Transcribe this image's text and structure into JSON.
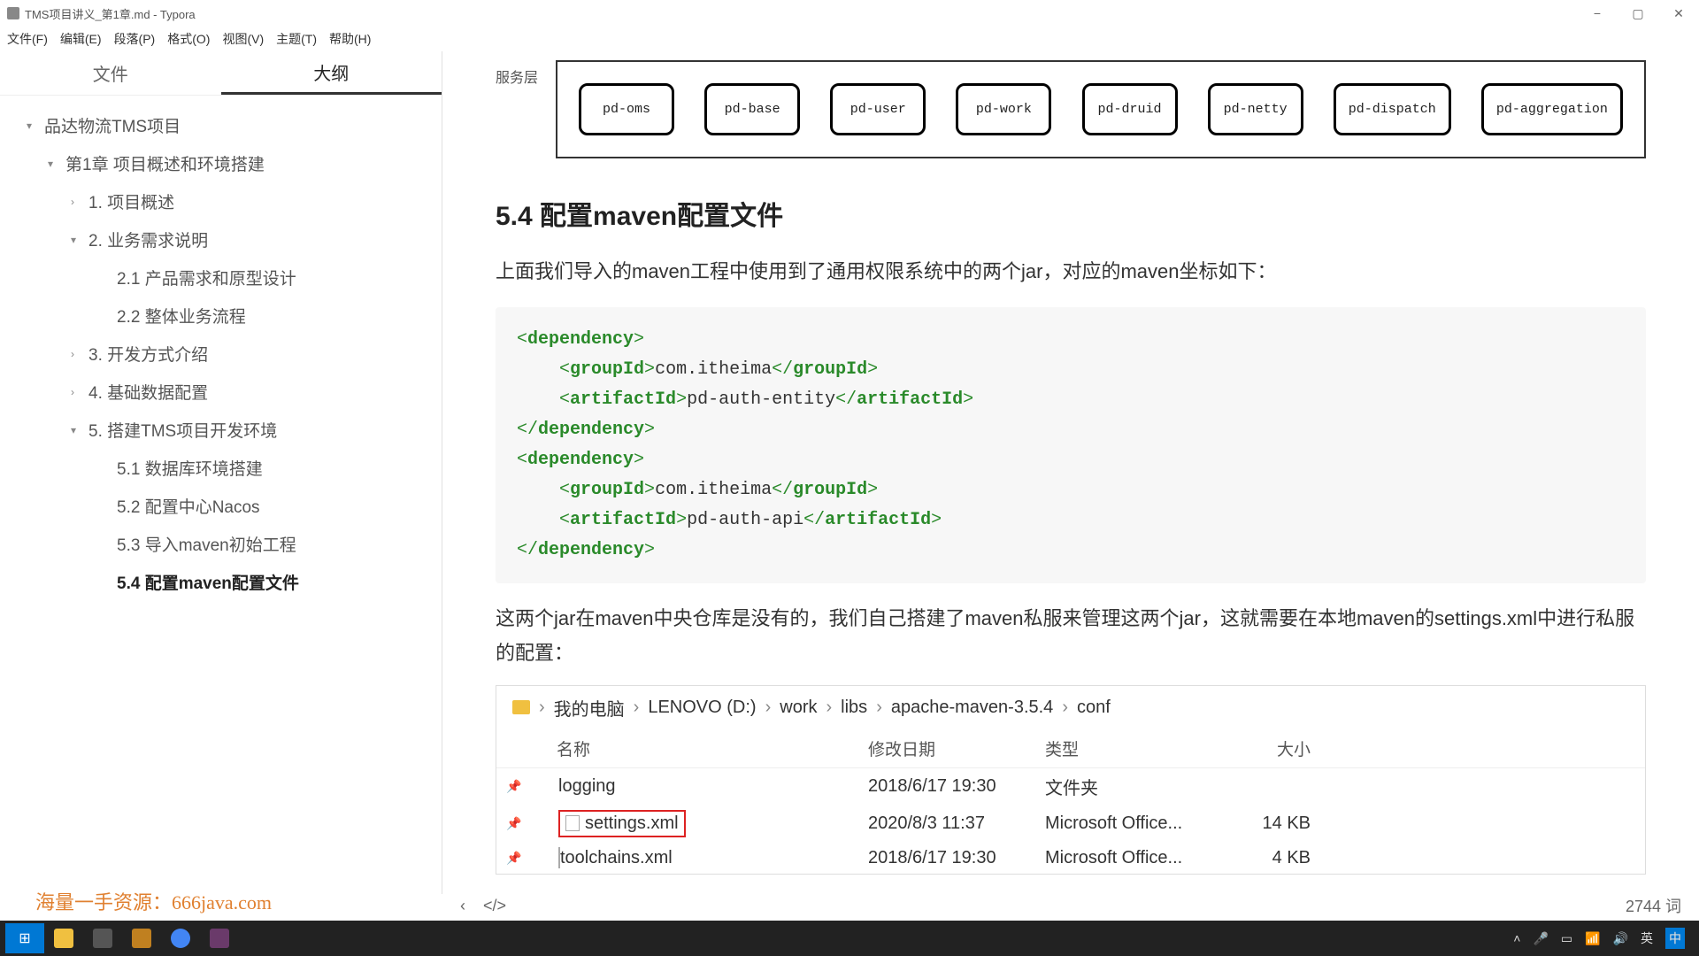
{
  "window": {
    "title": "TMS项目讲义_第1章.md - Typora"
  },
  "menu": {
    "file": "文件(F)",
    "edit": "编辑(E)",
    "paragraph": "段落(P)",
    "format": "格式(O)",
    "view": "视图(V)",
    "theme": "主题(T)",
    "help": "帮助(H)"
  },
  "sidebar": {
    "tab_files": "文件",
    "tab_outline": "大纲",
    "items": [
      {
        "label": "品达物流TMS项目",
        "level": 1,
        "chev": "▾"
      },
      {
        "label": "第1章 项目概述和环境搭建",
        "level": 2,
        "chev": "▾"
      },
      {
        "label": "1. 项目概述",
        "level": 3,
        "chev": "›"
      },
      {
        "label": "2. 业务需求说明",
        "level": 3,
        "chev": "▾"
      },
      {
        "label": "2.1 产品需求和原型设计",
        "level": 4,
        "chev": ""
      },
      {
        "label": "2.2 整体业务流程",
        "level": 4,
        "chev": ""
      },
      {
        "label": "3. 开发方式介绍",
        "level": 3,
        "chev": "›"
      },
      {
        "label": "4. 基础数据配置",
        "level": 3,
        "chev": "›"
      },
      {
        "label": "5. 搭建TMS项目开发环境",
        "level": 3,
        "chev": "▾"
      },
      {
        "label": "5.1 数据库环境搭建",
        "level": 4,
        "chev": ""
      },
      {
        "label": "5.2 配置中心Nacos",
        "level": 4,
        "chev": ""
      },
      {
        "label": "5.3 导入maven初始工程",
        "level": 4,
        "chev": ""
      },
      {
        "label": "5.4 配置maven配置文件",
        "level": 4,
        "chev": "",
        "bold": true
      }
    ]
  },
  "content": {
    "service_label": "服务层",
    "services": [
      "pd-oms",
      "pd-base",
      "pd-user",
      "pd-work",
      "pd-druid",
      "pd-netty",
      "pd-dispatch",
      "pd-aggregation"
    ],
    "heading": "5.4 配置maven配置文件",
    "para1": "上面我们导入的maven工程中使用到了通用权限系统中的两个jar，对应的maven坐标如下：",
    "code": {
      "dep1_group": "com.itheima",
      "dep1_artifact": "pd-auth-entity",
      "dep2_group": "com.itheima",
      "dep2_artifact": "pd-auth-api"
    },
    "para2": "这两个jar在maven中央仓库是没有的，我们自己搭建了maven私服来管理这两个jar，这就需要在本地maven的settings.xml中进行私服的配置：",
    "breadcrumb": [
      "我的电脑",
      "LENOVO (D:)",
      "work",
      "libs",
      "apache-maven-3.5.4",
      "conf"
    ],
    "file_headers": {
      "name": "名称",
      "date": "修改日期",
      "type": "类型",
      "size": "大小"
    },
    "files": [
      {
        "name": "logging",
        "date": "2018/6/17 19:30",
        "type": "文件夹",
        "size": "",
        "folder": true
      },
      {
        "name": "settings.xml",
        "date": "2020/8/3 11:37",
        "type": "Microsoft Office...",
        "size": "14 KB",
        "highlight": true
      },
      {
        "name": "toolchains.xml",
        "date": "2018/6/17 19:30",
        "type": "Microsoft Office...",
        "size": "4 KB"
      }
    ]
  },
  "status": {
    "back": "‹",
    "code_toggle": "</>",
    "words": "2744 词"
  },
  "watermark": "海量一手资源：666java.com",
  "tray": {
    "lang": "英",
    "ime": "㆗"
  }
}
